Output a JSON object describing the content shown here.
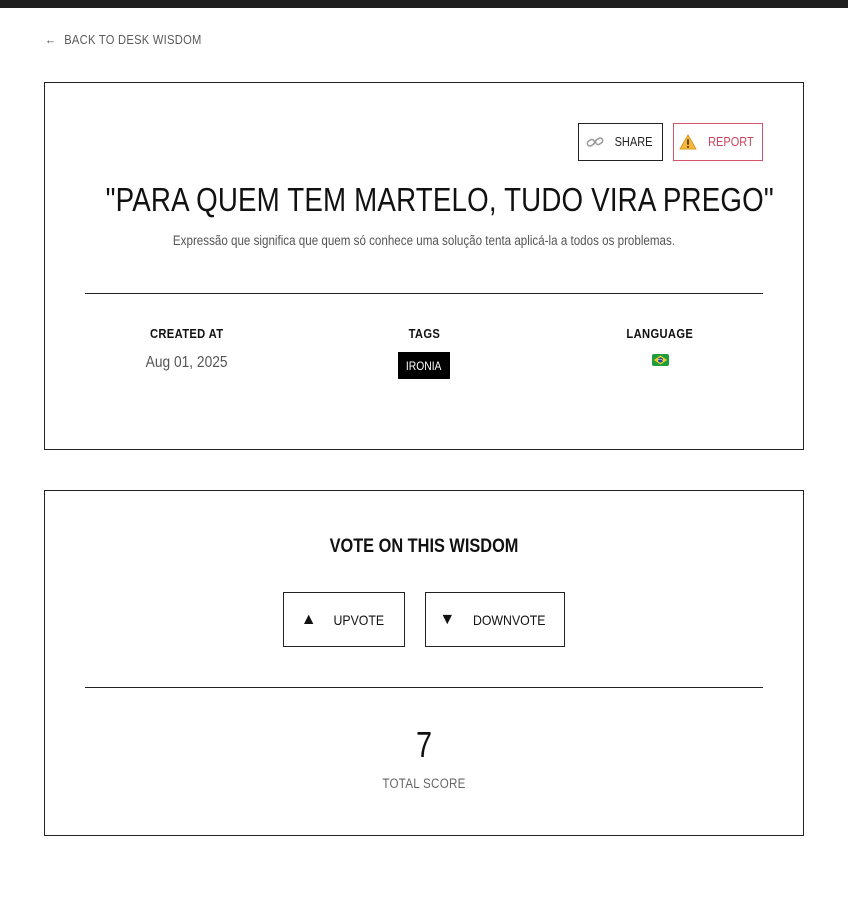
{
  "nav": {
    "back_label": "BACK TO DESK WISDOM",
    "back_icon": "arrow-left-icon"
  },
  "wisdom": {
    "share_label": "SHARE",
    "share_icon": "link-icon",
    "report_label": "REPORT",
    "report_icon": "warning-icon",
    "title": "\"PARA QUEM TEM MARTELO, TUDO VIRA PREGO\"",
    "description": "Expressão que significa que quem só conhece uma solução tenta aplicá-la a todos os problemas.",
    "meta": {
      "created_at_label": "CREATED AT",
      "created_at_value": "Aug 01, 2025",
      "tags_label": "TAGS",
      "tags": [
        "IRONIA"
      ],
      "language_label": "LANGUAGE",
      "language_flag": "brazil-flag-icon"
    }
  },
  "vote": {
    "title": "VOTE ON THIS WISDOM",
    "upvote_label": "UPVOTE",
    "downvote_label": "DOWNVOTE",
    "score": "7",
    "score_label": "TOTAL SCORE"
  },
  "colors": {
    "topbar": "#1f1f1f",
    "report_accent": "#c8455c",
    "tag_bg": "#000000"
  }
}
